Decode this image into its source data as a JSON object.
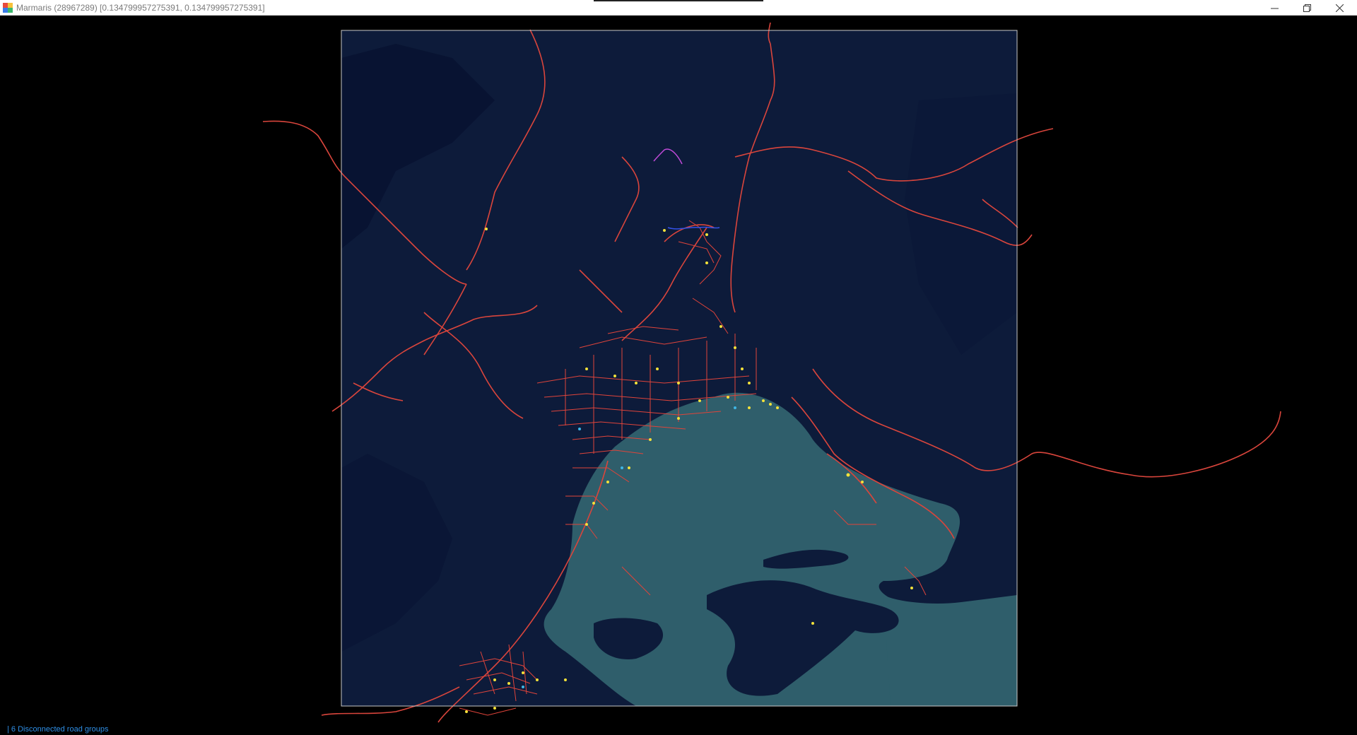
{
  "window": {
    "title": "Marmaris (28967289) [0.134799957275391, 0.134799957275391]"
  },
  "controls": {
    "minimize_icon": "minimize-icon",
    "restore_icon": "restore-icon",
    "close_icon": "close-icon"
  },
  "colors": {
    "background": "#000000",
    "land": "#0d1b3a",
    "land_dark": "#091634",
    "water": "#2f5e6b",
    "road": "#e0443a",
    "road_highway": "#d9453c",
    "poi_yellow": "#f4e23a",
    "poi_cyan": "#3fb6e6",
    "status_text": "#2f8fe6",
    "frame": "#c8c8c8"
  },
  "status": {
    "text": "| 6 Disconnected road groups"
  }
}
